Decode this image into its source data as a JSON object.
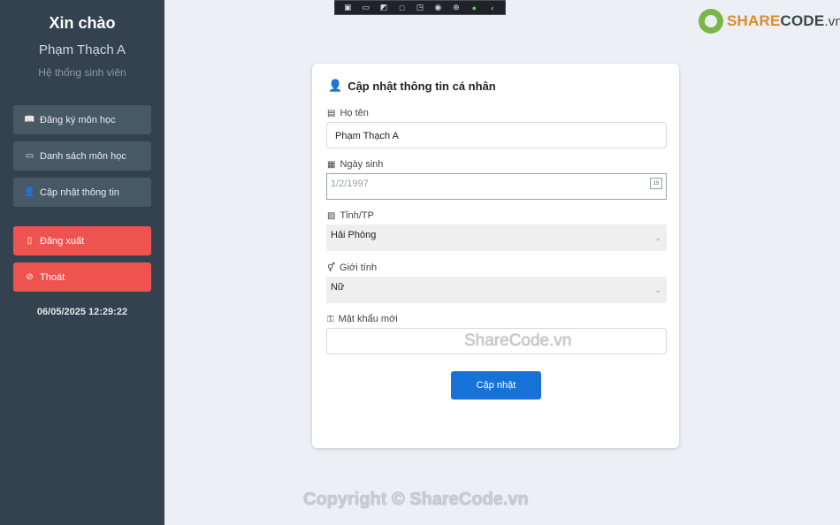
{
  "sidebar": {
    "greeting": "Xin chào",
    "user_name": "Phạm Thạch A",
    "subtitle": "Hệ thống sinh viên",
    "items": [
      {
        "label": "Đăng ký môn học",
        "icon": "book-open-icon"
      },
      {
        "label": "Danh sách môn học",
        "icon": "book-icon"
      },
      {
        "label": "Cập nhật thông tin",
        "icon": "user-icon"
      }
    ],
    "logout_label": "Đăng xuất",
    "exit_label": "Thoát",
    "clock": "06/05/2025 12:29:22"
  },
  "logo": {
    "part1": "SHARE",
    "part2": "CODE",
    "part3": ".vn"
  },
  "form": {
    "title": "Cập nhật thông tin cá nhân",
    "name_label": "Họ tên",
    "name_value": "Phạm Thạch A",
    "dob_label": "Ngày sinh",
    "dob_value": "1/2/1997",
    "city_label": "Tỉnh/TP",
    "city_value": "Hải Phòng",
    "gender_label": "Giới tính",
    "gender_value": "Nữ",
    "password_label": "Mật khẩu mới",
    "password_value": "",
    "submit_label": "Cập nhật"
  },
  "watermark": {
    "center": "ShareCode.vn",
    "footer": "Copyright © ShareCode.vn"
  },
  "colors": {
    "sidebar_bg": "#33424e",
    "nav_button": "#485966",
    "danger": "#ef5350",
    "primary": "#1772d8"
  }
}
